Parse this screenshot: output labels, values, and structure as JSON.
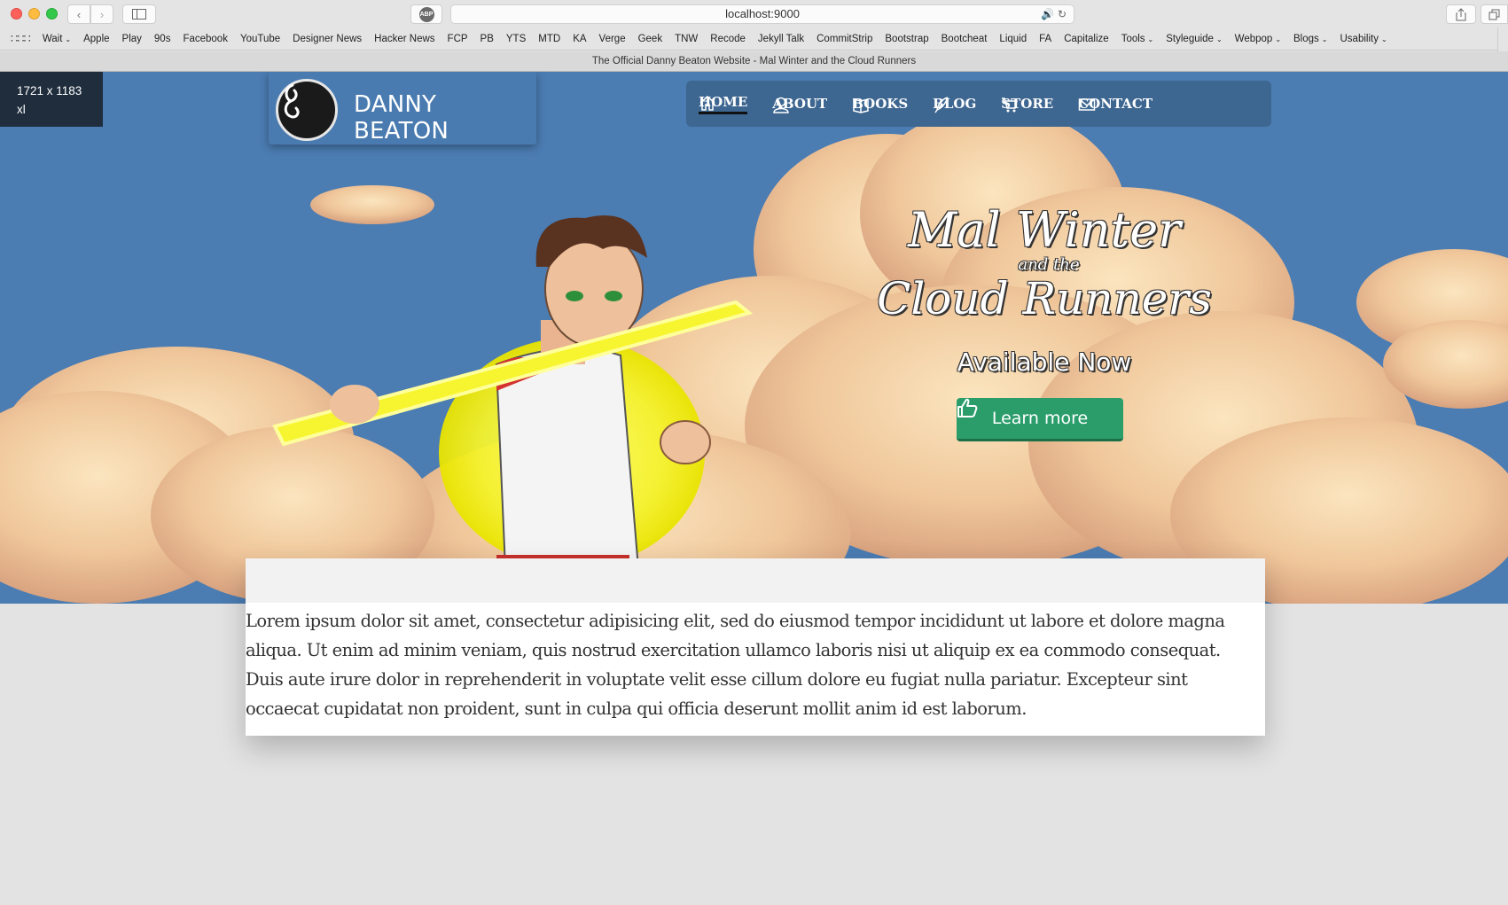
{
  "browser": {
    "url": "localhost:9000",
    "tab_title": "The Official Danny Beaton Website - Mal Winter and the Cloud Runners",
    "bookmarks": [
      {
        "label": "Wait",
        "has_menu": true
      },
      {
        "label": "Apple",
        "has_menu": false
      },
      {
        "label": "Play",
        "has_menu": false
      },
      {
        "label": "90s",
        "has_menu": false
      },
      {
        "label": "Facebook",
        "has_menu": false
      },
      {
        "label": "YouTube",
        "has_menu": false
      },
      {
        "label": "Designer News",
        "has_menu": false
      },
      {
        "label": "Hacker News",
        "has_menu": false
      },
      {
        "label": "FCP",
        "has_menu": false
      },
      {
        "label": "PB",
        "has_menu": false
      },
      {
        "label": "YTS",
        "has_menu": false
      },
      {
        "label": "MTD",
        "has_menu": false
      },
      {
        "label": "KA",
        "has_menu": false
      },
      {
        "label": "Verge",
        "has_menu": false
      },
      {
        "label": "Geek",
        "has_menu": false
      },
      {
        "label": "TNW",
        "has_menu": false
      },
      {
        "label": "Recode",
        "has_menu": false
      },
      {
        "label": "Jekyll Talk",
        "has_menu": false
      },
      {
        "label": "CommitStrip",
        "has_menu": false
      },
      {
        "label": "Bootstrap",
        "has_menu": false
      },
      {
        "label": "Bootcheat",
        "has_menu": false
      },
      {
        "label": "Liquid",
        "has_menu": false
      },
      {
        "label": "FA",
        "has_menu": false
      },
      {
        "label": "Capitalize",
        "has_menu": false
      },
      {
        "label": "Tools",
        "has_menu": true
      },
      {
        "label": "Styleguide",
        "has_menu": true
      },
      {
        "label": "Webpop",
        "has_menu": true
      },
      {
        "label": "Blogs",
        "has_menu": true
      },
      {
        "label": "Usability",
        "has_menu": true
      }
    ]
  },
  "debug": {
    "size": "1721 x 1183",
    "breakpoint": "xl"
  },
  "site": {
    "brand_name": "DANNY BEATON",
    "nav": [
      {
        "label": "HOME",
        "icon": "home-icon",
        "active": true
      },
      {
        "label": "ABOUT",
        "icon": "user-icon",
        "active": false
      },
      {
        "label": "BOOKS",
        "icon": "book-icon",
        "active": false
      },
      {
        "label": "BLOG",
        "icon": "quill-icon",
        "active": false
      },
      {
        "label": "STORE",
        "icon": "cart-icon",
        "active": false
      },
      {
        "label": "CONTACT",
        "icon": "envelope-icon",
        "active": false
      }
    ]
  },
  "hero": {
    "title_line1": "Mal Winter",
    "title_line2": "and the",
    "title_line3": "Cloud Runners",
    "subtitle": "Available Now",
    "cta_label": "Learn more",
    "cta_icon": "thumbs-up-icon",
    "colors": {
      "sky": "#4b7cb2",
      "cta": "#2a9d6b"
    }
  },
  "content": {
    "body": "Lorem ipsum dolor sit amet, consectetur adipisicing elit, sed do eiusmod tempor incididunt ut labore et dolore magna aliqua. Ut enim ad minim veniam, quis nostrud exercitation ullamco laboris nisi ut aliquip ex ea commodo consequat. Duis aute irure dolor in reprehenderit in voluptate velit esse cillum dolore eu fugiat nulla pariatur. Excepteur sint occaecat cupidatat non proident, sunt in culpa qui officia deserunt mollit anim id est laborum."
  }
}
